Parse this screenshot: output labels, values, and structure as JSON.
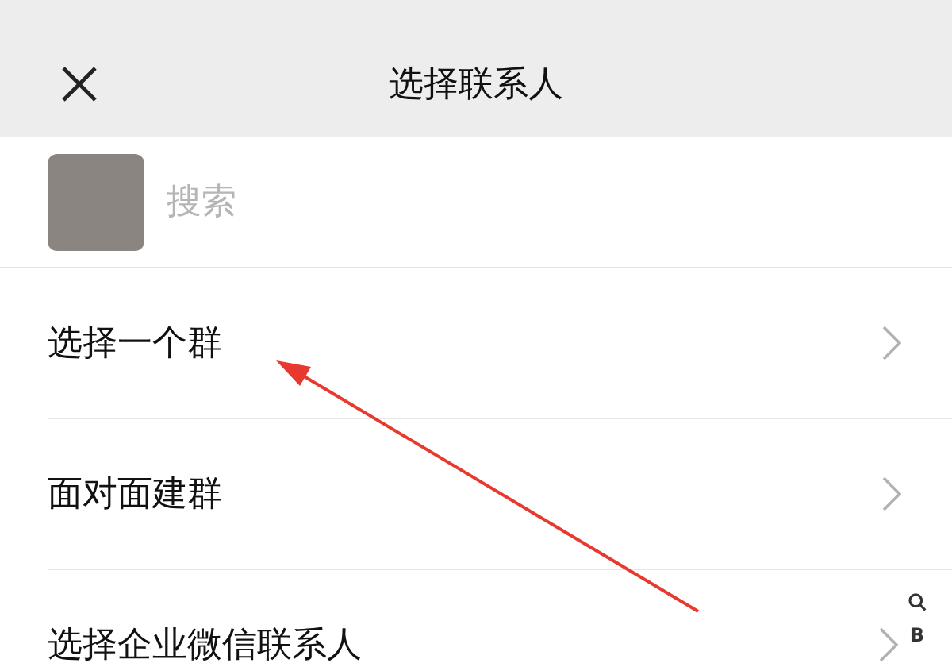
{
  "header": {
    "title": "选择联系人"
  },
  "search": {
    "placeholder": "搜索"
  },
  "menu": [
    {
      "label": "选择一个群"
    },
    {
      "label": "面对面建群"
    },
    {
      "label": "选择企业微信联系人"
    }
  ],
  "index_bar": {
    "letters": [
      "B"
    ]
  }
}
